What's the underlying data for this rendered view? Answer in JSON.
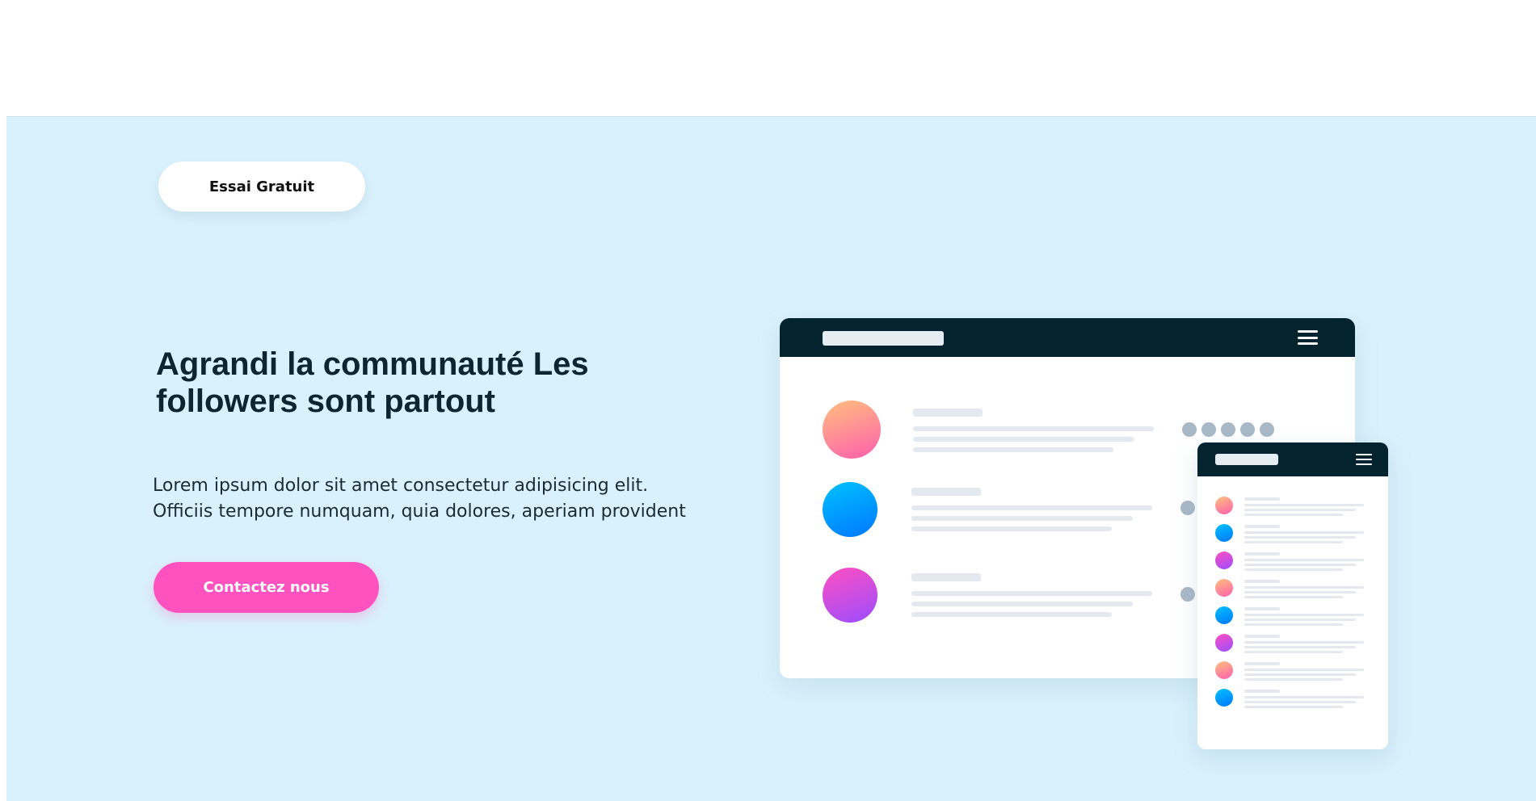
{
  "hero": {
    "trial_button_label": "Essai Gratuit",
    "headline": "Agrandi la communauté Les followers sont partout",
    "lead_text": "Lorem ipsum dolor sit amet consectetur adipisicing elit. Officiis tempore numquam, quia dolores, aperiam provident",
    "contact_button_label": "Contactez nous"
  },
  "colors": {
    "hero_background": "#d9f1fc",
    "accent_pink": "#ff52bf",
    "window_bar": "#03232f"
  },
  "illustration": {
    "desktop_window": {
      "menu_icon": "hamburger-menu-icon",
      "rows": [
        {
          "avatar_style": "orange-pink-gradient"
        },
        {
          "avatar_style": "blue-gradient"
        },
        {
          "avatar_style": "pink-purple-gradient"
        }
      ]
    },
    "mobile_window": {
      "menu_icon": "hamburger-menu-icon",
      "rows": [
        {
          "avatar_style": "orange-pink-gradient"
        },
        {
          "avatar_style": "blue-gradient"
        },
        {
          "avatar_style": "pink-purple-gradient"
        },
        {
          "avatar_style": "orange-pink-gradient"
        },
        {
          "avatar_style": "blue-gradient"
        },
        {
          "avatar_style": "pink-purple-gradient"
        },
        {
          "avatar_style": "orange-pink-gradient"
        },
        {
          "avatar_style": "blue-gradient"
        }
      ]
    }
  }
}
